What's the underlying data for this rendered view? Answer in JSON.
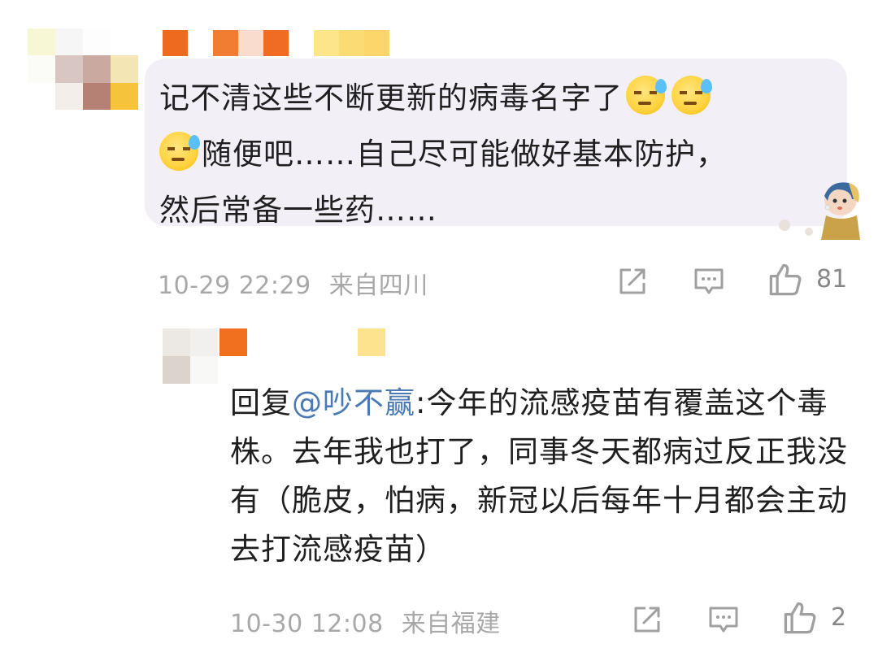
{
  "comment": {
    "text_line1": "记不清这些不断更新的病毒名字了",
    "text_line2": "随便吧……自己尽可能做好基本防护，",
    "text_line3": "然后常备一些药……",
    "emoji": "sweat-smile-emoji",
    "time": "10-29 22:29",
    "location": "来自四川",
    "likes": "81"
  },
  "reply": {
    "prefix": "回复",
    "mention": "@吵不赢",
    "text_first": ":今年的流感疫苗有覆盖",
    "text_rest": "这个毒株。去年我也打了，同事冬天都病过反正我没有（脆皮，怕病，新冠以后每年十月都会主动去打流感疫苗）",
    "time": "10-30 12:08",
    "location": "来自福建",
    "likes": "2"
  },
  "colors": {
    "bubble_bg": "#f3eff7",
    "mention": "#4a7ab6",
    "meta_text": "#a8a8a8"
  }
}
